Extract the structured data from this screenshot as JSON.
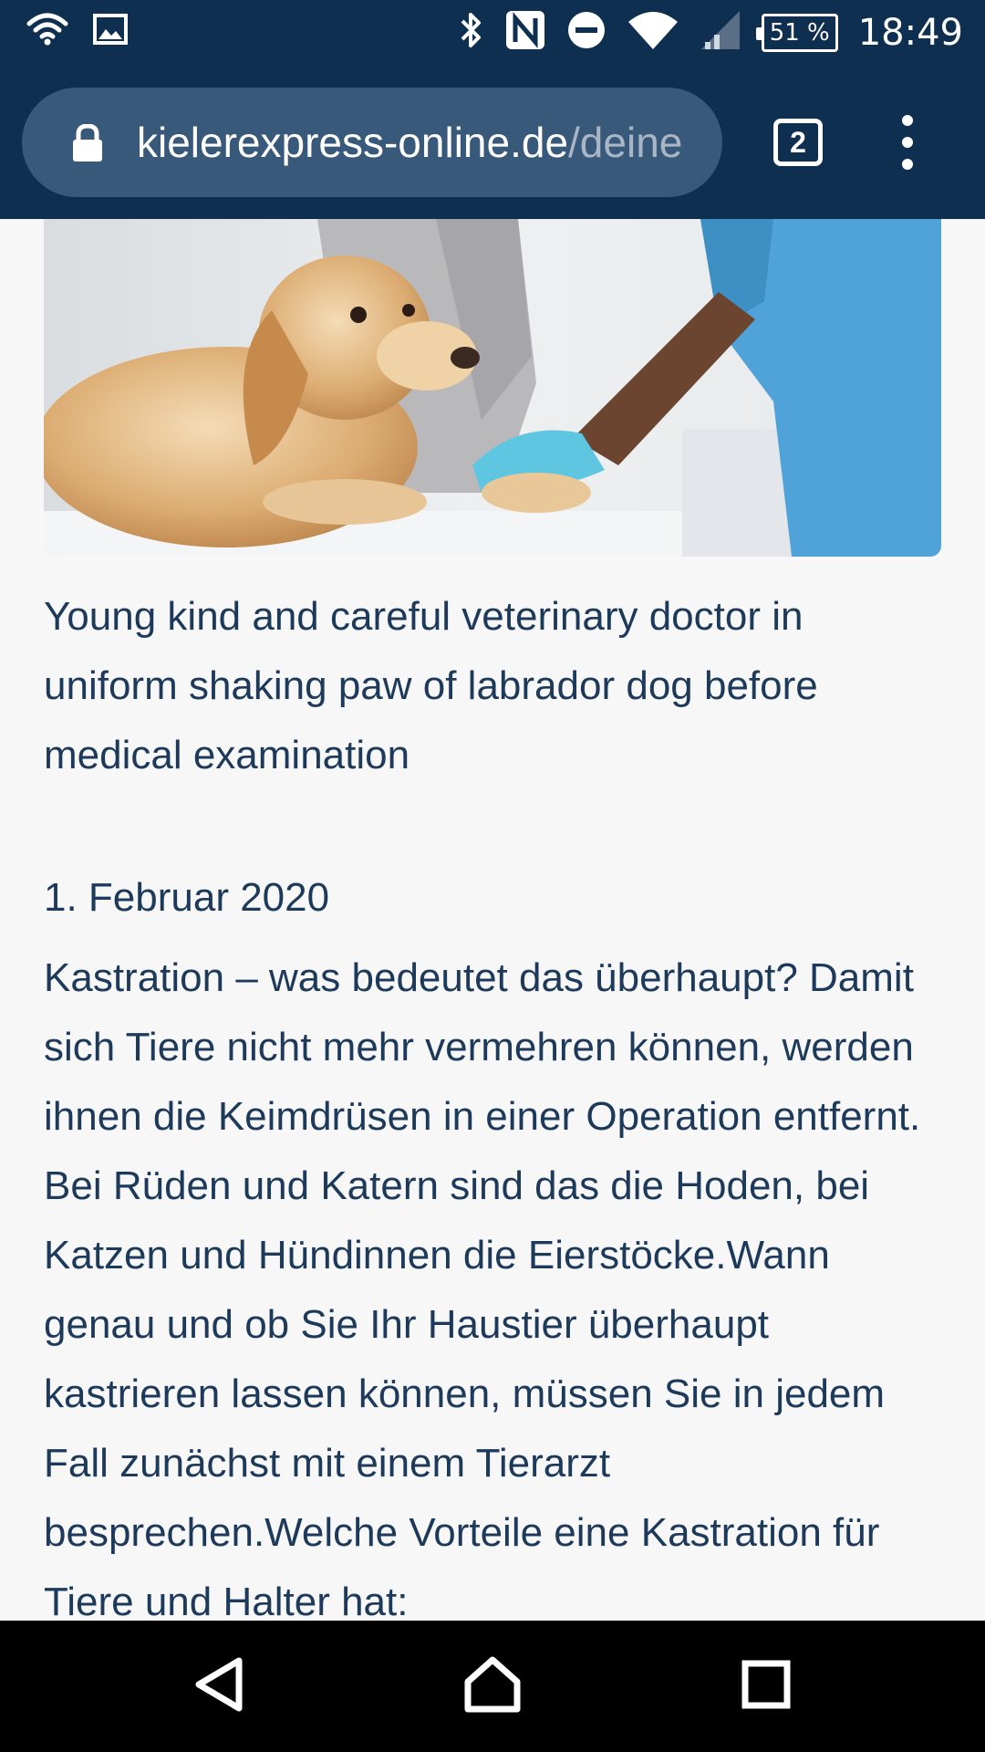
{
  "status_bar": {
    "left_icons": [
      "wifi-icon",
      "image-icon"
    ],
    "right_icons": [
      "bluetooth-icon",
      "nfc-icon",
      "do-not-disturb-icon",
      "wifi-icon",
      "signal-icon"
    ],
    "battery": "51 %",
    "time": "18:49"
  },
  "browser": {
    "url_domain": "kielerexpress-online.de",
    "url_path": "/deine",
    "tab_count": "2"
  },
  "article": {
    "image_icon": "hero-photo",
    "caption": "Young kind and careful veterinary doctor in uniform shaking paw of labrador dog before medical examination",
    "date": "1. Februar 2020",
    "body": "Kastration – was bedeutet das überhaupt? Damit sich Tiere nicht mehr vermehren können, werden ihnen die Keimdrüsen in einer Operation entfernt. Bei Rüden und Katern sind das die Hoden, bei Katzen und Hündinnen die Eierstöcke.Wann genau und ob Sie Ihr Haustier überhaupt kastrieren lassen können, müssen Sie in jedem Fall zunächst mit einem Tierarzt besprechen.Welche Vorteile eine Kastration für Tiere und Halter hat:"
  },
  "nav": {
    "icons": [
      "back-icon",
      "home-icon",
      "recents-icon"
    ]
  }
}
